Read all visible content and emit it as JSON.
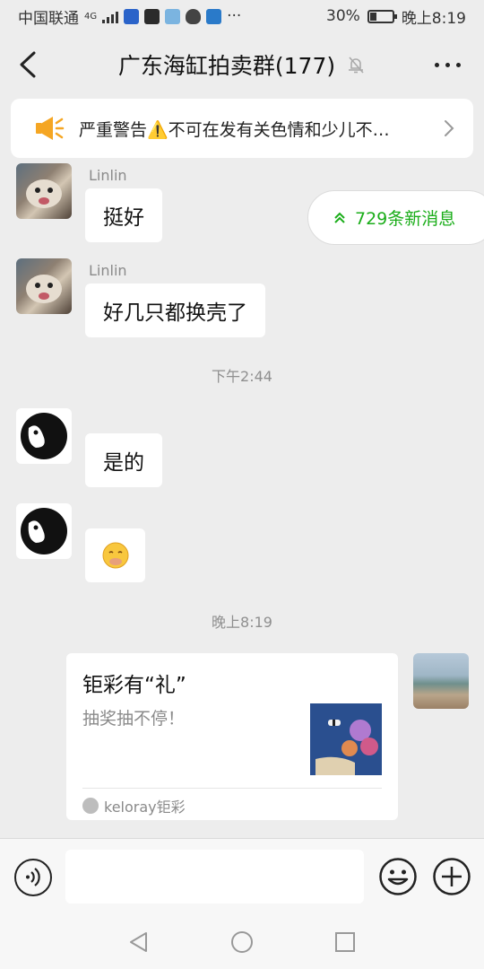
{
  "status_bar": {
    "carrier": "中国联通",
    "network": "4G",
    "battery_percent": "30%",
    "battery_level": 0.3,
    "time": "晚上8:19"
  },
  "header": {
    "title": "广东海缸拍卖群(177)",
    "icons": [
      "back-chevron-icon",
      "mute-bell-icon",
      "more-dots-icon"
    ]
  },
  "notice": {
    "text": "严重警告⚠️不可在发有关色情和少儿不…",
    "icon": "megaphone-icon",
    "accent": "#f5a623"
  },
  "new_messages": {
    "label": "729条新消息",
    "color": "#1aad19"
  },
  "messages": [
    {
      "sender": "Linlin",
      "text": "挺好",
      "avatar": "dog-photo"
    },
    {
      "sender": "Linlin",
      "text": "好几只都换壳了",
      "avatar": "dog-photo"
    },
    {
      "timestamp": "下午2:44"
    },
    {
      "text": "是的",
      "avatar": "panda-logo"
    },
    {
      "emoji": "🤭",
      "avatar": "panda-logo"
    },
    {
      "timestamp": "晚上8:19"
    }
  ],
  "card": {
    "title": "钜彩有“礼”",
    "description": "抽奖抽不停！",
    "source": "keloray钜彩",
    "avatar": "seaside-photo"
  },
  "input": {
    "value": "",
    "placeholder": ""
  }
}
